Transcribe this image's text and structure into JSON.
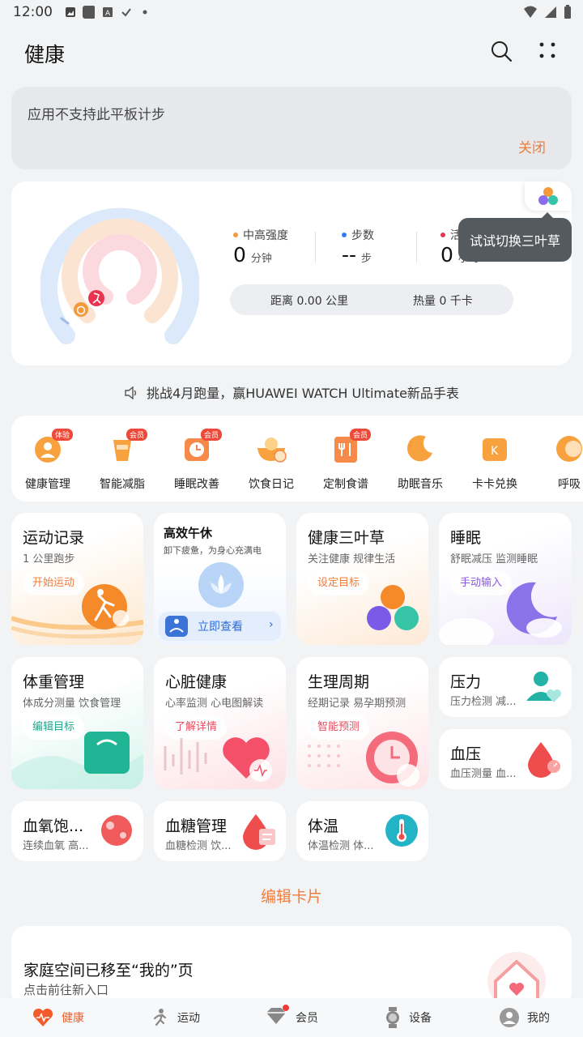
{
  "status": {
    "time": "12:00"
  },
  "header": {
    "title": "健康"
  },
  "notice": {
    "text": "应用不支持此平板计步",
    "close": "关闭"
  },
  "activity": {
    "intensity": {
      "label": "中高强度",
      "value": "0",
      "unit": "分钟",
      "color": "#f39a3d"
    },
    "steps": {
      "label": "步数",
      "value": "--",
      "unit": "步",
      "color": "#2f7cf6"
    },
    "active": {
      "label": "活",
      "value": "0",
      "unit": "小时",
      "color": "#e8344e"
    },
    "distance": "距离 0.00 公里",
    "calories": "热量 0 千卡",
    "tooltip": "试试切换三叶草"
  },
  "announcement": "挑战4月跑量，赢HUAWEI WATCH Ultimate新品手表",
  "services": [
    {
      "label": "健康管理",
      "badge": "体验"
    },
    {
      "label": "智能减脂",
      "badge": "会员"
    },
    {
      "label": "睡眠改善",
      "badge": "会员"
    },
    {
      "label": "饮食日记",
      "badge": ""
    },
    {
      "label": "定制食谱",
      "badge": "会员"
    },
    {
      "label": "助眠音乐",
      "badge": ""
    },
    {
      "label": "卡卡兑换",
      "badge": ""
    },
    {
      "label": "呼吸",
      "badge": ""
    }
  ],
  "cards": {
    "exercise": {
      "title": "运动记录",
      "sub": "1 公里跑步",
      "btn": "开始运动"
    },
    "nap": {
      "title": "高效午休",
      "sub": "卸下疲惫，为身心充满电",
      "btn": "立即查看"
    },
    "clover": {
      "title": "健康三叶草",
      "sub": "关注健康 规律生活",
      "btn": "设定目标"
    },
    "sleep": {
      "title": "睡眠",
      "sub": "舒眠减压 监测睡眠",
      "btn": "手动输入"
    },
    "weight": {
      "title": "体重管理",
      "sub": "体成分测量 饮食管理",
      "btn": "编辑目标"
    },
    "heart": {
      "title": "心脏健康",
      "sub": "心率监测 心电图解读",
      "btn": "了解详情"
    },
    "cycle": {
      "title": "生理周期",
      "sub": "经期记录 易孕期预测",
      "btn": "智能预测"
    },
    "stress": {
      "title": "压力",
      "sub": "压力检测 减..."
    },
    "bp": {
      "title": "血压",
      "sub": "血压测量 血..."
    },
    "spo2": {
      "title": "血氧饱...",
      "sub": "连续血氧 高..."
    },
    "glucose": {
      "title": "血糖管理",
      "sub": "血糖检测 饮..."
    },
    "temp": {
      "title": "体温",
      "sub": "体温检测 体..."
    }
  },
  "edit_cards": "编辑卡片",
  "family": {
    "title": "家庭空间已移至“我的”页",
    "sub": "点击前往新入口"
  },
  "nav": [
    {
      "label": "健康",
      "icon": "heart-icon"
    },
    {
      "label": "运动",
      "icon": "run-icon"
    },
    {
      "label": "会员",
      "icon": "diamond-icon"
    },
    {
      "label": "设备",
      "icon": "watch-icon"
    },
    {
      "label": "我的",
      "icon": "person-icon"
    }
  ]
}
